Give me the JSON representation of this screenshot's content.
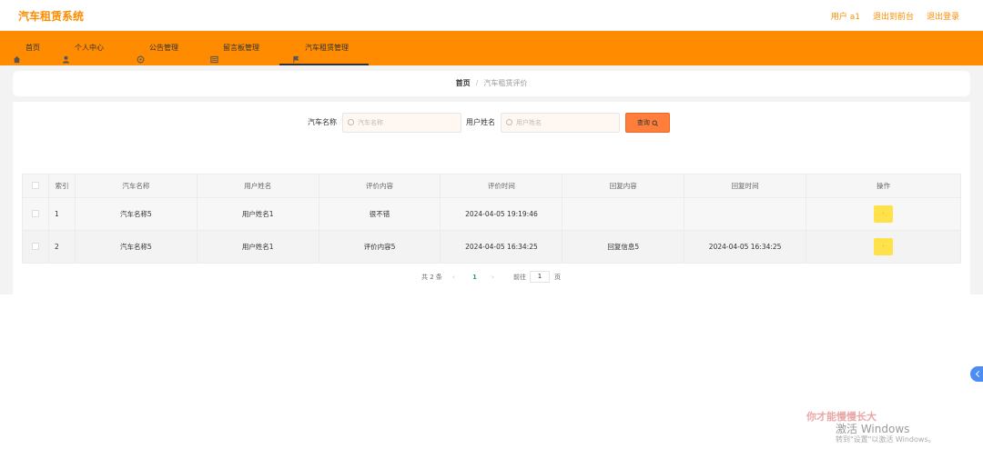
{
  "header": {
    "title": "汽车租赁系统",
    "links": [
      "用户 a1",
      "退出到前台",
      "退出登录"
    ]
  },
  "nav": {
    "items": [
      {
        "label": "首页",
        "icon": "home-icon"
      },
      {
        "label": "个人中心",
        "icon": "user-icon"
      },
      {
        "label": "公告管理",
        "icon": "notice-icon"
      },
      {
        "label": "留言板管理",
        "icon": "message-icon"
      },
      {
        "label": "汽车租赁管理",
        "icon": "car-icon"
      }
    ],
    "active_index": 4
  },
  "breadcrumb": {
    "home": "首页",
    "separator": "/",
    "current": "汽车租赁评价"
  },
  "search": {
    "car_name_label": "汽车名称",
    "car_name_placeholder": "汽车名称",
    "user_name_label": "用户姓名",
    "user_name_placeholder": "用户姓名",
    "button_label": "查询"
  },
  "table": {
    "headers": [
      "索引",
      "汽车名称",
      "用户姓名",
      "评价内容",
      "评价时间",
      "回复内容",
      "回复时间",
      "操作"
    ],
    "rows": [
      {
        "index": "1",
        "car_name": "汽车名称5",
        "user_name": "用户姓名1",
        "content": "很不错",
        "time": "2024-04-05 19:19:46",
        "reply": "",
        "reply_time": ""
      },
      {
        "index": "2",
        "car_name": "汽车名称5",
        "user_name": "用户姓名1",
        "content": "评价内容5",
        "time": "2024-04-05 16:34:25",
        "reply": "回复信息5",
        "reply_time": "2024-04-05 16:34:25"
      }
    ]
  },
  "pagination": {
    "total": "共 2 条",
    "prev": "‹",
    "current_page": "1",
    "next": "›",
    "goto_label": "前往",
    "goto_value": "1",
    "page_unit": "页"
  },
  "watermark": {
    "line1": "你才能慢慢长大",
    "line2": "激活 Windows",
    "line3": "转到\"设置\"以激活 Windows。"
  },
  "colors": {
    "brand": "#ff8c00",
    "search_button": "#ff7e3c",
    "action_button": "#ffe14a"
  }
}
